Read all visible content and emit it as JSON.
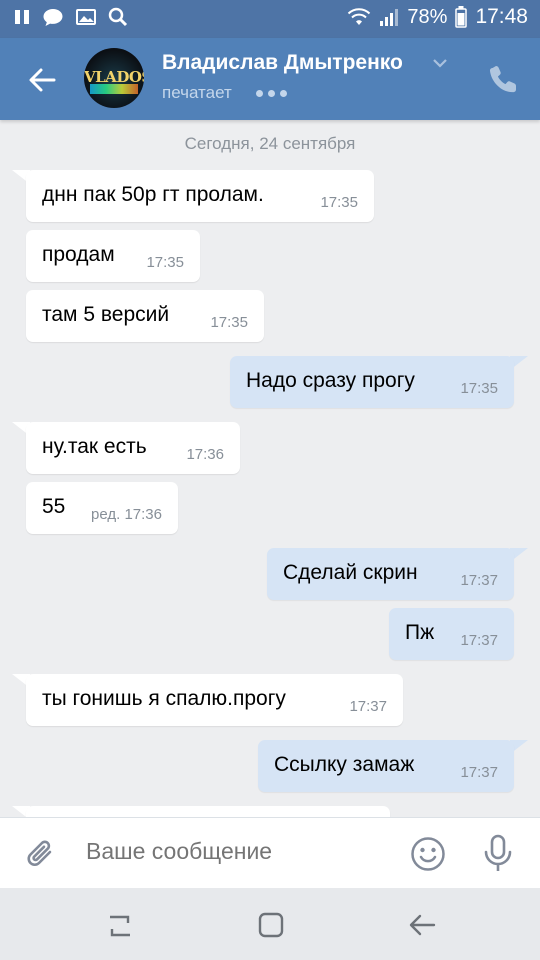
{
  "status_bar": {
    "battery": "78%",
    "time": "17:48"
  },
  "header": {
    "avatar_text": "VLADOS",
    "contact_name": "Владислав Дмытренко",
    "status": "печатает"
  },
  "chat": {
    "date_label": "Сегодня, 24 сентября",
    "messages": [
      {
        "dir": "in",
        "text": "днн пак 50р гт пролам.",
        "time": "17:35"
      },
      {
        "dir": "in",
        "text": "продам",
        "time": "17:35"
      },
      {
        "dir": "in",
        "text": "там 5 версий",
        "time": "17:35"
      },
      {
        "dir": "out",
        "text": "Надо сразу прогу",
        "time": "17:35"
      },
      {
        "dir": "in",
        "text": "ну.так есть",
        "time": "17:36"
      },
      {
        "dir": "in",
        "text": "55",
        "time": "ред. 17:36"
      },
      {
        "dir": "out",
        "text": "Сделай скрин",
        "time": "17:37"
      },
      {
        "dir": "out",
        "text": "Пж",
        "time": "17:37"
      },
      {
        "dir": "in",
        "text": "ты гонишь я спалю.прогу",
        "time": "17:37"
      },
      {
        "dir": "out",
        "text": "Ссылку замаж",
        "time": "17:37"
      }
    ]
  },
  "composer": {
    "placeholder": "Ваше сообщение"
  },
  "colors": {
    "header": "#5181b8",
    "status_bar": "#4e74a6",
    "incoming_bubble": "#ffffff",
    "outgoing_bubble": "#d6e4f5",
    "chat_background": "#edeef0"
  },
  "icons": [
    "pause-icon",
    "chat-icon",
    "image-icon",
    "search-icon",
    "wifi-icon",
    "signal-icon",
    "battery-icon",
    "back-arrow-icon",
    "chevron-down-icon",
    "phone-icon",
    "paperclip-icon",
    "emoji-icon",
    "mic-icon",
    "recent-apps-icon",
    "home-icon",
    "nav-back-icon"
  ]
}
